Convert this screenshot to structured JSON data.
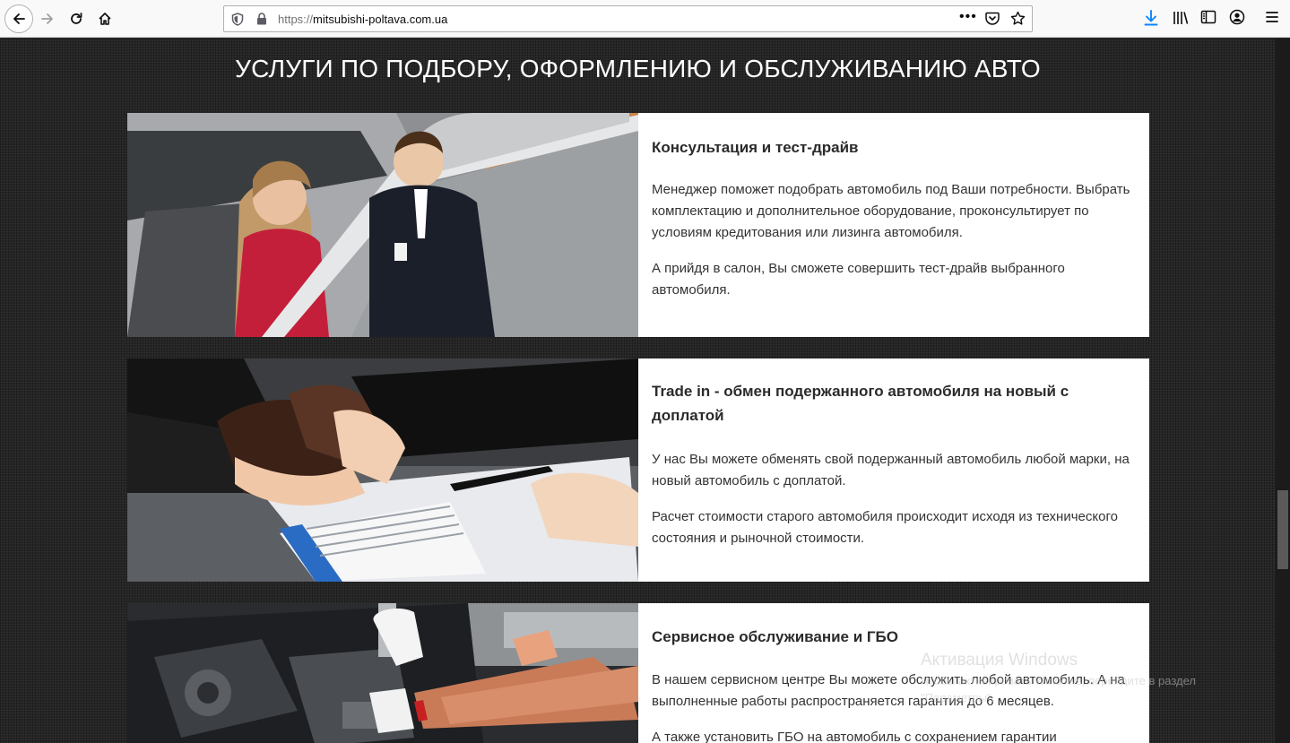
{
  "browser": {
    "url_scheme": "https://",
    "url_host": "mitsubishi-poltava.com.ua",
    "page_actions_label": "•••",
    "icons": [
      "back-icon",
      "forward-icon",
      "reload-icon",
      "home-icon",
      "tracking-shield-icon",
      "lock-icon",
      "pocket-icon",
      "bookmark-star-icon",
      "download-icon",
      "library-icon",
      "sidebar-icon",
      "account-icon",
      "menu-icon"
    ]
  },
  "section": {
    "title": "УСЛУГИ ПО ПОДБОРУ, ОФОРМЛЕНИЮ И ОБСЛУЖИВАНИЮ АВТО"
  },
  "services": [
    {
      "title": "Консультация и тест-драйв",
      "paragraphs": [
        "Менеджер поможет подобрать автомобиль под Ваши потребности. Выбрать комплектацию и дополнительное оборудование, проконсультирует по условиям кредитования или лизинга автомобиля.",
        "А прийдя в салон, Вы сможете совершить тест-драйв выбранного автомобиля."
      ],
      "image": "consultation-photo"
    },
    {
      "title": "Trade in - обмен подержанного автомобиля на новый с доплатой",
      "paragraphs": [
        "У нас Вы можете обменять свой подержанный автомобиль любой марки, на новый автомобиль с доплатой.",
        "Расчет стоимости старого автомобиля происходит исходя из технического состояния и рыночной стоимости."
      ],
      "image": "handshake-photo"
    },
    {
      "title": "Сервисное обслуживание и ГБО",
      "paragraphs": [
        "В нашем сервисном центре Вы можете обслужить любой автомобиль. А на выполненные работы распространяется гарантия до 6 месяцев.",
        "А также установить ГБО на автомобиль с сохранением гарантии"
      ],
      "image": "engine-service-photo"
    }
  ],
  "watermark": {
    "title": "Активация Windows",
    "text": "Чтобы активировать Windows, перейдите в раздел \"Параметры\"."
  }
}
